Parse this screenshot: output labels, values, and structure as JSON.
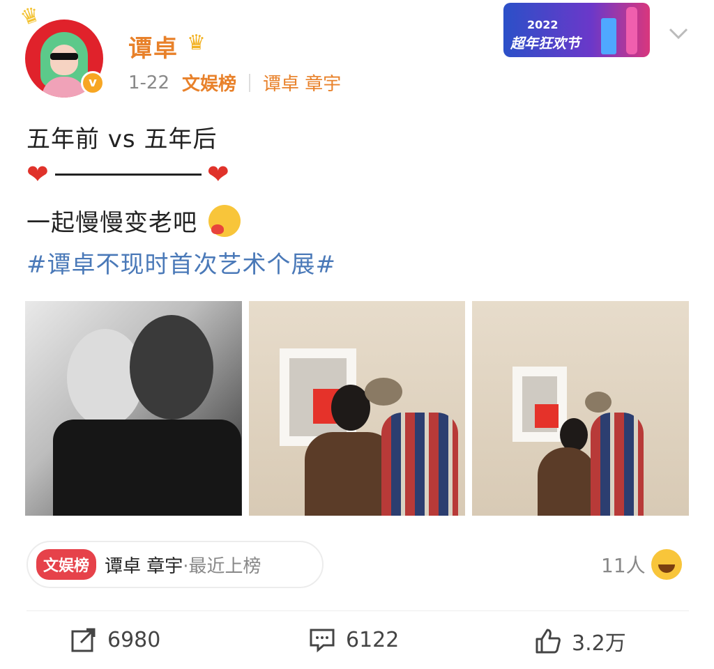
{
  "post": {
    "username": "谭卓",
    "date": "1-22",
    "rank_label": "文娱榜",
    "rank_names": "谭卓 章宇",
    "event_banner": {
      "year": "2022",
      "name": "超年狂欢节"
    },
    "lines": {
      "line1": "五年前 vs 五年后",
      "line3": "一起慢慢变老吧",
      "hashtag": "#谭卓不现时首次艺术个展#"
    }
  },
  "tag_pill": {
    "badge": "文娱榜",
    "names": "谭卓 章宇",
    "suffix": "·最近上榜"
  },
  "reactions": {
    "count": "11人"
  },
  "actions": {
    "repost": "6980",
    "comment": "6122",
    "like": "3.2万"
  },
  "icons": [
    "crown-icon",
    "verified-badge-icon",
    "chevron-down-icon",
    "heart-icon",
    "hug-emoji-icon",
    "laugh-emoji-icon",
    "repost-icon",
    "comment-icon",
    "like-icon"
  ],
  "colors": {
    "username": "#e8812a",
    "hashtag": "#4a79b8",
    "heart": "#e0322a",
    "badge": "#e6424a"
  }
}
